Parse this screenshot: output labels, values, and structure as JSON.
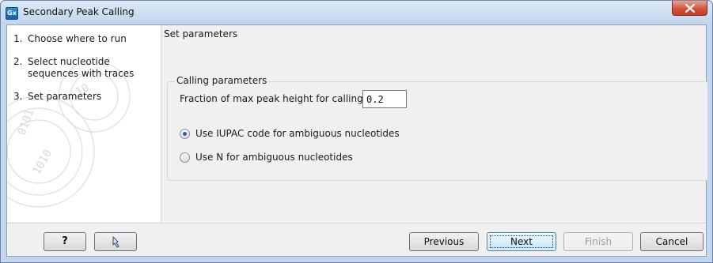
{
  "window": {
    "title": "Secondary Peak Calling",
    "app_icon_text": "Gx"
  },
  "wizard_steps": [
    {
      "num": "1.",
      "label": "Choose where to run"
    },
    {
      "num": "2.",
      "label": "Select nucleotide sequences with traces"
    },
    {
      "num": "3.",
      "label": "Set parameters"
    }
  ],
  "main": {
    "section_title": "Set parameters",
    "group": {
      "title": "Calling parameters",
      "field_label": "Fraction of max peak height for calling",
      "field_value": "0.2",
      "options": [
        {
          "label": "Use IUPAC code for ambiguous nucleotides",
          "checked": true
        },
        {
          "label": "Use N for ambiguous nucleotides",
          "checked": false
        }
      ]
    }
  },
  "buttons": {
    "help": "?",
    "reset_icon": "reset-arrow-icon",
    "previous": "Previous",
    "next": "Next",
    "finish": "Finish",
    "cancel": "Cancel"
  },
  "colors": {
    "close_button": "#c43b22",
    "radio_checked": "#1e63b8",
    "default_button_border": "#3c7fb1"
  }
}
